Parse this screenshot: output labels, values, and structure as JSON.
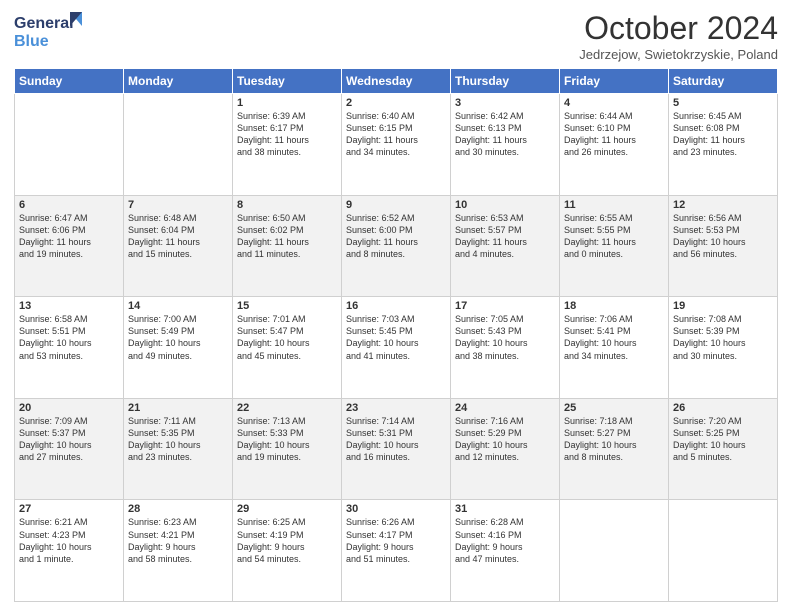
{
  "header": {
    "logo_general": "General",
    "logo_blue": "Blue",
    "month": "October 2024",
    "location": "Jedrzejow, Swietokrzyskie, Poland"
  },
  "weekdays": [
    "Sunday",
    "Monday",
    "Tuesday",
    "Wednesday",
    "Thursday",
    "Friday",
    "Saturday"
  ],
  "weeks": [
    [
      {
        "day": "",
        "info": ""
      },
      {
        "day": "",
        "info": ""
      },
      {
        "day": "1",
        "info": "Sunrise: 6:39 AM\nSunset: 6:17 PM\nDaylight: 11 hours\nand 38 minutes."
      },
      {
        "day": "2",
        "info": "Sunrise: 6:40 AM\nSunset: 6:15 PM\nDaylight: 11 hours\nand 34 minutes."
      },
      {
        "day": "3",
        "info": "Sunrise: 6:42 AM\nSunset: 6:13 PM\nDaylight: 11 hours\nand 30 minutes."
      },
      {
        "day": "4",
        "info": "Sunrise: 6:44 AM\nSunset: 6:10 PM\nDaylight: 11 hours\nand 26 minutes."
      },
      {
        "day": "5",
        "info": "Sunrise: 6:45 AM\nSunset: 6:08 PM\nDaylight: 11 hours\nand 23 minutes."
      }
    ],
    [
      {
        "day": "6",
        "info": "Sunrise: 6:47 AM\nSunset: 6:06 PM\nDaylight: 11 hours\nand 19 minutes."
      },
      {
        "day": "7",
        "info": "Sunrise: 6:48 AM\nSunset: 6:04 PM\nDaylight: 11 hours\nand 15 minutes."
      },
      {
        "day": "8",
        "info": "Sunrise: 6:50 AM\nSunset: 6:02 PM\nDaylight: 11 hours\nand 11 minutes."
      },
      {
        "day": "9",
        "info": "Sunrise: 6:52 AM\nSunset: 6:00 PM\nDaylight: 11 hours\nand 8 minutes."
      },
      {
        "day": "10",
        "info": "Sunrise: 6:53 AM\nSunset: 5:57 PM\nDaylight: 11 hours\nand 4 minutes."
      },
      {
        "day": "11",
        "info": "Sunrise: 6:55 AM\nSunset: 5:55 PM\nDaylight: 11 hours\nand 0 minutes."
      },
      {
        "day": "12",
        "info": "Sunrise: 6:56 AM\nSunset: 5:53 PM\nDaylight: 10 hours\nand 56 minutes."
      }
    ],
    [
      {
        "day": "13",
        "info": "Sunrise: 6:58 AM\nSunset: 5:51 PM\nDaylight: 10 hours\nand 53 minutes."
      },
      {
        "day": "14",
        "info": "Sunrise: 7:00 AM\nSunset: 5:49 PM\nDaylight: 10 hours\nand 49 minutes."
      },
      {
        "day": "15",
        "info": "Sunrise: 7:01 AM\nSunset: 5:47 PM\nDaylight: 10 hours\nand 45 minutes."
      },
      {
        "day": "16",
        "info": "Sunrise: 7:03 AM\nSunset: 5:45 PM\nDaylight: 10 hours\nand 41 minutes."
      },
      {
        "day": "17",
        "info": "Sunrise: 7:05 AM\nSunset: 5:43 PM\nDaylight: 10 hours\nand 38 minutes."
      },
      {
        "day": "18",
        "info": "Sunrise: 7:06 AM\nSunset: 5:41 PM\nDaylight: 10 hours\nand 34 minutes."
      },
      {
        "day": "19",
        "info": "Sunrise: 7:08 AM\nSunset: 5:39 PM\nDaylight: 10 hours\nand 30 minutes."
      }
    ],
    [
      {
        "day": "20",
        "info": "Sunrise: 7:09 AM\nSunset: 5:37 PM\nDaylight: 10 hours\nand 27 minutes."
      },
      {
        "day": "21",
        "info": "Sunrise: 7:11 AM\nSunset: 5:35 PM\nDaylight: 10 hours\nand 23 minutes."
      },
      {
        "day": "22",
        "info": "Sunrise: 7:13 AM\nSunset: 5:33 PM\nDaylight: 10 hours\nand 19 minutes."
      },
      {
        "day": "23",
        "info": "Sunrise: 7:14 AM\nSunset: 5:31 PM\nDaylight: 10 hours\nand 16 minutes."
      },
      {
        "day": "24",
        "info": "Sunrise: 7:16 AM\nSunset: 5:29 PM\nDaylight: 10 hours\nand 12 minutes."
      },
      {
        "day": "25",
        "info": "Sunrise: 7:18 AM\nSunset: 5:27 PM\nDaylight: 10 hours\nand 8 minutes."
      },
      {
        "day": "26",
        "info": "Sunrise: 7:20 AM\nSunset: 5:25 PM\nDaylight: 10 hours\nand 5 minutes."
      }
    ],
    [
      {
        "day": "27",
        "info": "Sunrise: 6:21 AM\nSunset: 4:23 PM\nDaylight: 10 hours\nand 1 minute."
      },
      {
        "day": "28",
        "info": "Sunrise: 6:23 AM\nSunset: 4:21 PM\nDaylight: 9 hours\nand 58 minutes."
      },
      {
        "day": "29",
        "info": "Sunrise: 6:25 AM\nSunset: 4:19 PM\nDaylight: 9 hours\nand 54 minutes."
      },
      {
        "day": "30",
        "info": "Sunrise: 6:26 AM\nSunset: 4:17 PM\nDaylight: 9 hours\nand 51 minutes."
      },
      {
        "day": "31",
        "info": "Sunrise: 6:28 AM\nSunset: 4:16 PM\nDaylight: 9 hours\nand 47 minutes."
      },
      {
        "day": "",
        "info": ""
      },
      {
        "day": "",
        "info": ""
      }
    ]
  ]
}
